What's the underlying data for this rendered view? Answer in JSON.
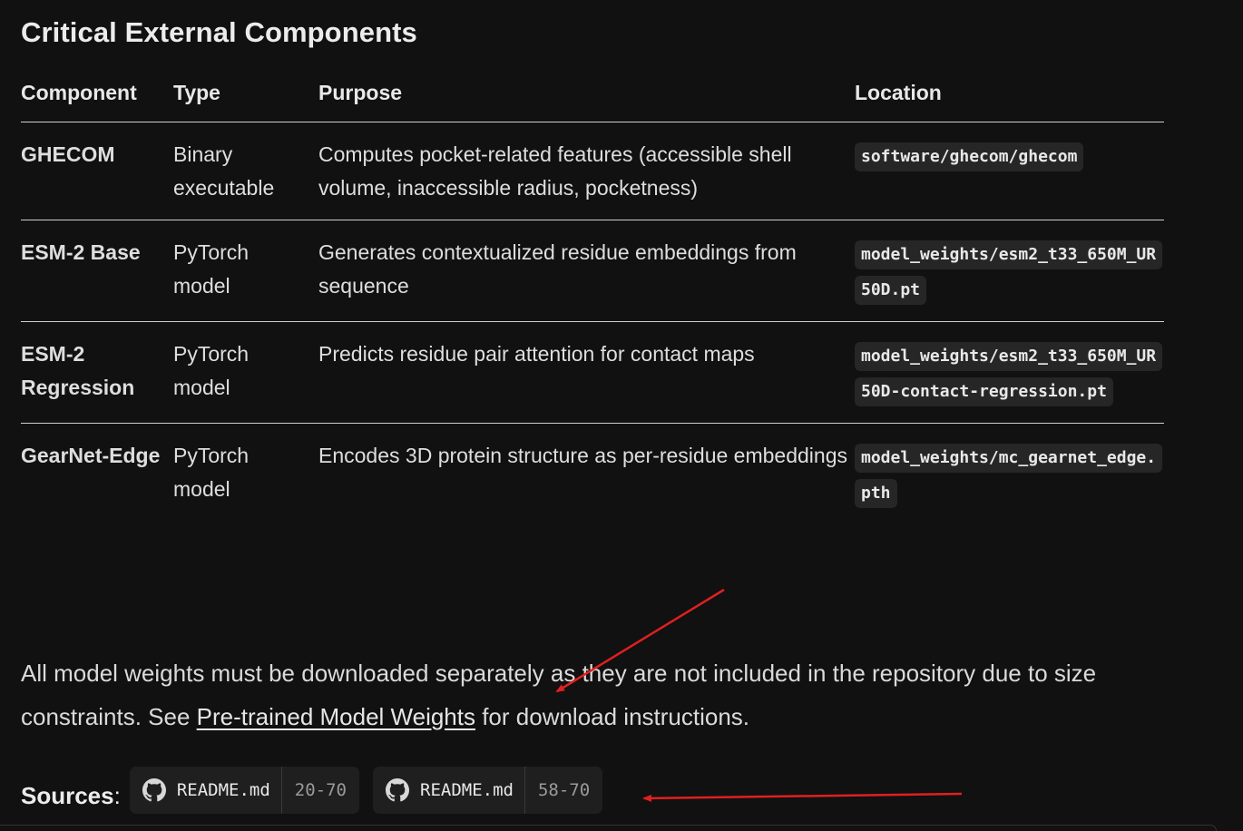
{
  "section": {
    "title": "Critical External Components"
  },
  "table": {
    "headers": [
      "Component",
      "Type",
      "Purpose",
      "Location"
    ],
    "rows": [
      {
        "component": "GHECOM",
        "type": "Binary executable",
        "purpose": "Computes pocket-related features (accessible shell volume, inaccessible radius, pocketness)",
        "location": "software/ghecom/ghecom"
      },
      {
        "component": "ESM-2 Base",
        "type": "PyTorch model",
        "purpose": "Generates contextualized residue embeddings from sequence",
        "location": "model_weights/esm2_t33_650M_UR50D.pt"
      },
      {
        "component": "ESM-2 Regression",
        "type": "PyTorch model",
        "purpose": "Predicts residue pair attention for contact maps",
        "location": "model_weights/esm2_t33_650M_UR50D-contact-regression.pt"
      },
      {
        "component": "GearNet-Edge",
        "type": "PyTorch model",
        "purpose": "Encodes 3D protein structure as per-residue embeddings",
        "location": "model_weights/mc_gearnet_edge.pth"
      }
    ]
  },
  "note": {
    "before": "All model weights must be downloaded separately as they are not included in the repository due to size constraints. See ",
    "link_text": "Pre-trained Model Weights",
    "after": " for download instructions."
  },
  "sources": {
    "label": "Sources",
    "colon": ":",
    "chips": [
      {
        "file": "README.md",
        "range": "20-70",
        "icon": "github-icon"
      },
      {
        "file": "README.md",
        "range": "58-70",
        "icon": "github-icon"
      }
    ]
  },
  "colors": {
    "background": "#111111",
    "text": "#e6e6e6",
    "code_bg": "#262626",
    "chip_bg": "#1f1f1f",
    "annotation_arrow": "#e02020"
  }
}
